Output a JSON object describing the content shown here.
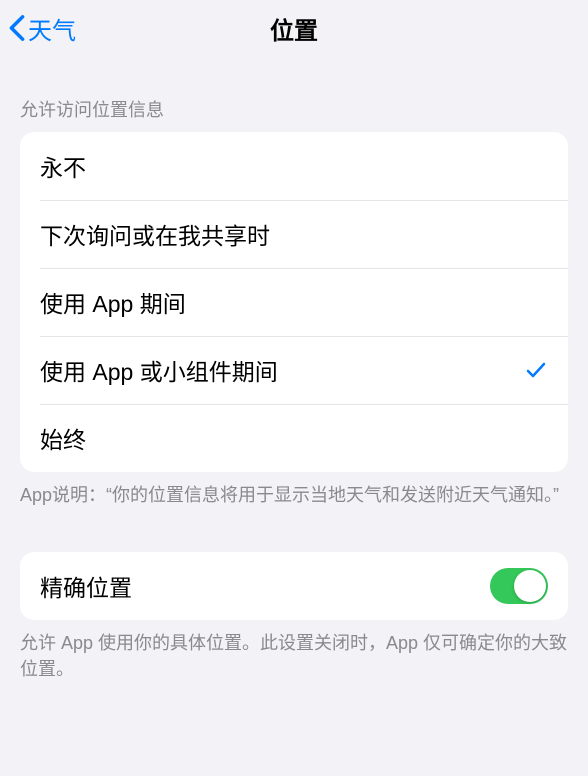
{
  "navbar": {
    "back_label": "天气",
    "title": "位置"
  },
  "access_section": {
    "header": "允许访问位置信息",
    "options": [
      {
        "label": "永不",
        "selected": false
      },
      {
        "label": "下次询问或在我共享时",
        "selected": false
      },
      {
        "label": "使用 App 期间",
        "selected": false
      },
      {
        "label": "使用 App 或小组件期间",
        "selected": true
      },
      {
        "label": "始终",
        "selected": false
      }
    ],
    "footer": "App说明：“你的位置信息将用于显示当地天气和发送附近天气通知。”"
  },
  "precise_section": {
    "label": "精确位置",
    "enabled": true,
    "footer": "允许 App 使用你的具体位置。此设置关闭时，App 仅可确定你的大致位置。"
  }
}
